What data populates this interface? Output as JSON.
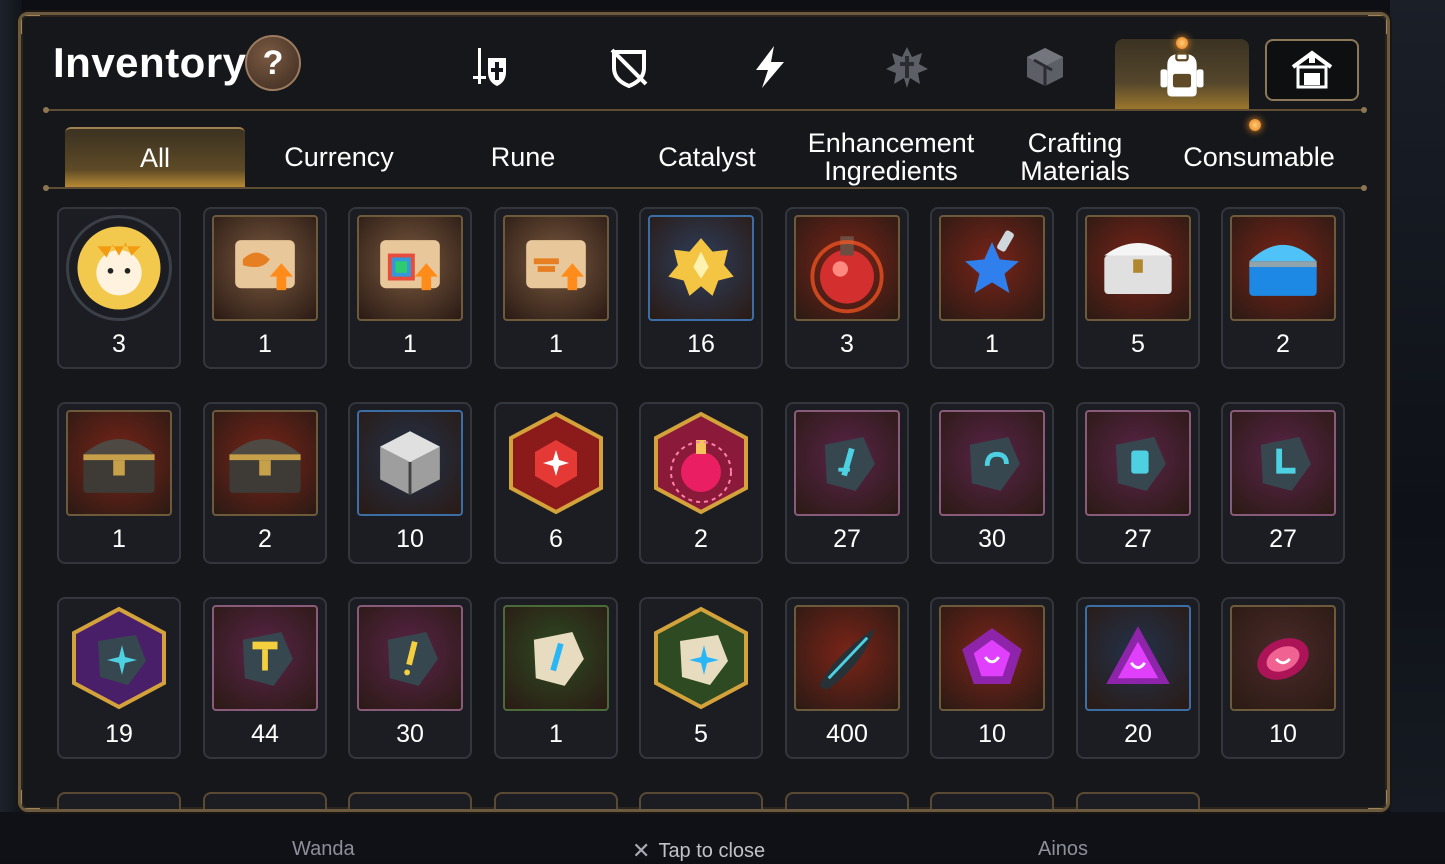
{
  "header": {
    "title": "Inventory",
    "help_label": "?"
  },
  "top_tabs": [
    {
      "icon": "knight-icon",
      "active": false
    },
    {
      "icon": "shield-slash-icon",
      "active": false
    },
    {
      "icon": "lightning-icon",
      "active": false
    },
    {
      "icon": "artifact-icon",
      "active": false
    },
    {
      "icon": "cube-icon",
      "active": false
    },
    {
      "icon": "backpack-icon",
      "active": true,
      "notification": true
    },
    {
      "icon": "storage-house-icon",
      "active": false
    }
  ],
  "category_tabs": [
    {
      "label": "All",
      "active": true
    },
    {
      "label": "Currency",
      "active": false
    },
    {
      "label": "Rune",
      "active": false
    },
    {
      "label": "Catalyst",
      "active": false
    },
    {
      "label": "Enhancement Ingredients",
      "active": false
    },
    {
      "label": "Crafting Materials",
      "active": false
    },
    {
      "label": "Consumable",
      "active": false,
      "notification": true
    }
  ],
  "items": [
    [
      {
        "icon": "mascot-coin-icon",
        "count": "3"
      },
      {
        "icon": "dragon-scroll-icon",
        "count": "1"
      },
      {
        "icon": "rainbow-scroll-icon",
        "count": "1"
      },
      {
        "icon": "rune-scroll-icon",
        "count": "1"
      },
      {
        "icon": "gold-crystal-icon",
        "count": "16"
      },
      {
        "icon": "red-potion-icon",
        "count": "3"
      },
      {
        "icon": "star-potion-icon",
        "count": "1"
      },
      {
        "icon": "silver-chest-icon",
        "count": "5"
      },
      {
        "icon": "crystal-chest-icon",
        "count": "2"
      }
    ],
    [
      {
        "icon": "dark-chest-icon",
        "count": "1"
      },
      {
        "icon": "dark-chest-icon",
        "count": "2"
      },
      {
        "icon": "silver-cube-icon",
        "count": "10"
      },
      {
        "icon": "red-gem-icon",
        "count": "6"
      },
      {
        "icon": "pink-potion-icon",
        "count": "2"
      },
      {
        "icon": "sword-stone-icon",
        "count": "27"
      },
      {
        "icon": "spiral-stone-icon",
        "count": "30"
      },
      {
        "icon": "armor-stone-icon",
        "count": "27"
      },
      {
        "icon": "boot-stone-icon",
        "count": "27"
      }
    ],
    [
      {
        "icon": "star-stone-icon",
        "count": "19"
      },
      {
        "icon": "hammer-stone-icon",
        "count": "44"
      },
      {
        "icon": "exclaim-stone-icon",
        "count": "30"
      },
      {
        "icon": "bone-sword-stone-icon",
        "count": "1"
      },
      {
        "icon": "bone-star-stone-icon",
        "count": "5"
      },
      {
        "icon": "shard-feather-icon",
        "count": "400"
      },
      {
        "icon": "pink-pentagon-icon",
        "count": "10"
      },
      {
        "icon": "pink-triangle-icon",
        "count": "20"
      },
      {
        "icon": "pink-oval-icon",
        "count": "10"
      }
    ]
  ],
  "footer": {
    "left_name": "Wanda",
    "close_hint": "Tap to close",
    "right_name": "Ainos"
  },
  "colors": {
    "frame_gold": "#6b5a3f",
    "active_tab_gold": "#b68a34",
    "panel_bg": "#16171b",
    "notification": "#ff9a2a"
  }
}
